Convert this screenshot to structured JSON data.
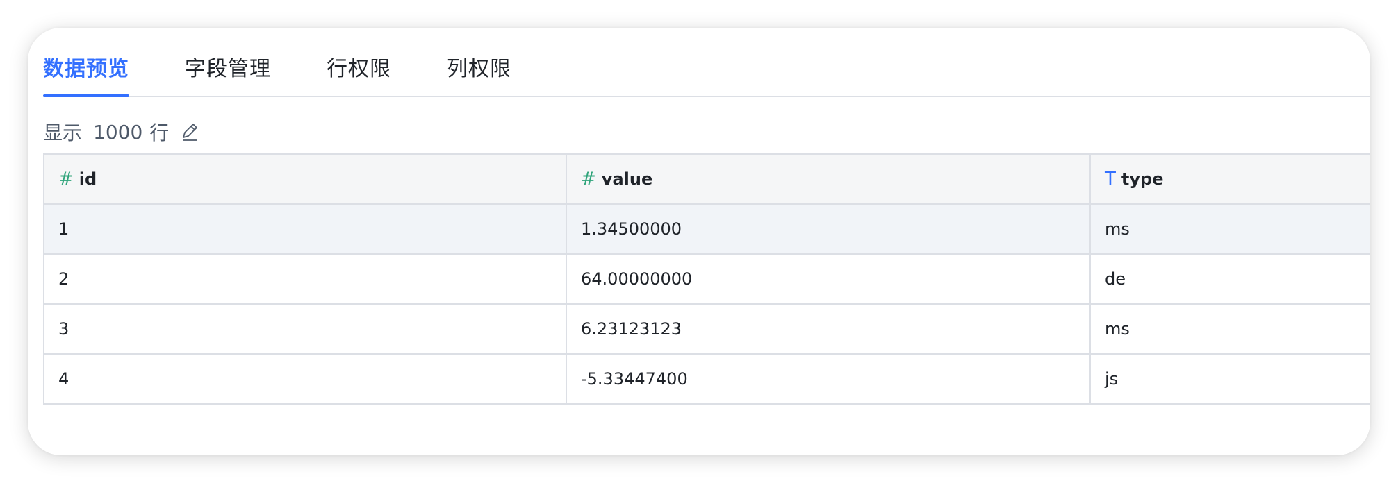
{
  "tabs": [
    {
      "label": "数据预览",
      "active": true
    },
    {
      "label": "字段管理",
      "active": false
    },
    {
      "label": "行权限",
      "active": false
    },
    {
      "label": "列权限",
      "active": false
    }
  ],
  "row_info": {
    "prefix": "显示",
    "count": "1000",
    "suffix": "行",
    "icon": "edit-icon"
  },
  "table": {
    "columns": [
      {
        "icon_glyph": "#",
        "icon": "number-type-icon",
        "label": "id"
      },
      {
        "icon_glyph": "#",
        "icon": "number-type-icon",
        "label": "value"
      },
      {
        "icon_glyph": "T",
        "icon": "text-type-icon",
        "label": "type"
      }
    ],
    "rows": [
      [
        "1",
        "1.34500000",
        "ms"
      ],
      [
        "2",
        "64.00000000",
        "de"
      ],
      [
        "3",
        "6.23123123",
        "ms"
      ],
      [
        "4",
        "-5.33447400",
        "js"
      ]
    ]
  },
  "colors": {
    "accent": "#3370ff",
    "number_icon": "#2ea47a",
    "text_icon": "#3370ff",
    "header_bg": "#f5f6f7",
    "hover_row_bg": "#f1f4f8"
  }
}
